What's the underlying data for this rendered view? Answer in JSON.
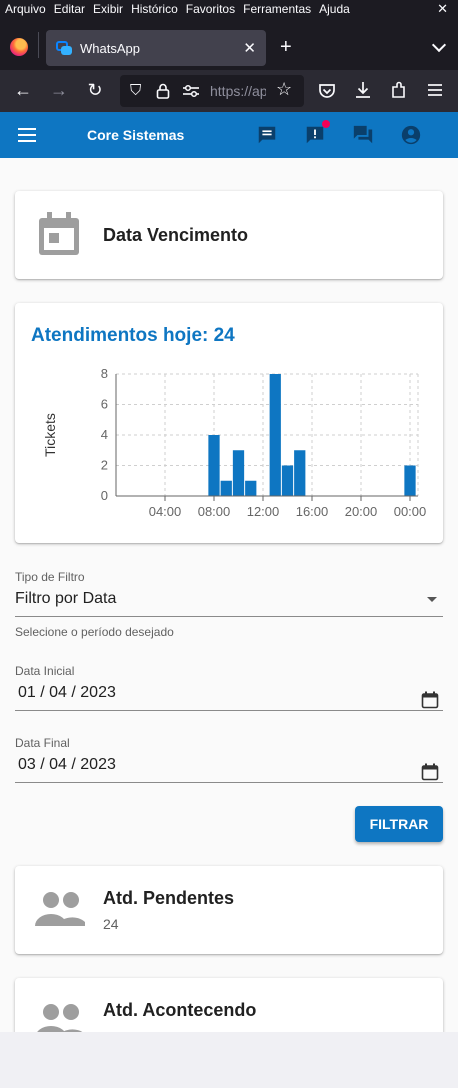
{
  "browser": {
    "menu": [
      "Arquivo",
      "Editar",
      "Exibir",
      "Histórico",
      "Favoritos",
      "Ferramentas",
      "Ajuda"
    ],
    "tab_title": "WhatsApp",
    "url_text": "https://ap",
    "icons": [
      "firefox-logo",
      "back-arrow",
      "forward-arrow",
      "reload",
      "shield",
      "lock",
      "permissions",
      "star",
      "pocket",
      "download",
      "extensions",
      "hamburger-menu"
    ]
  },
  "app": {
    "title": "Core Sistemas",
    "header_icons": [
      "chat-icon",
      "alert-icon",
      "forum-icon",
      "account-icon"
    ]
  },
  "due_card": {
    "title": "Data Vencimento",
    "icon": "calendar-icon"
  },
  "chart_card": {
    "title": "Atendimentos hoje: 24"
  },
  "chart_data": {
    "type": "bar",
    "ylabel": "Tickets",
    "xlabel": "",
    "ylim": [
      0,
      8
    ],
    "yticks": [
      "0",
      "2",
      "4",
      "6",
      "8"
    ],
    "xticks": [
      "04:00",
      "08:00",
      "12:00",
      "16:00",
      "20:00",
      "00:00"
    ],
    "x_range_hours": [
      0,
      24
    ],
    "bars": [
      {
        "hour": 8,
        "value": 4
      },
      {
        "hour": 9,
        "value": 1
      },
      {
        "hour": 10,
        "value": 3
      },
      {
        "hour": 11,
        "value": 1
      },
      {
        "hour": 13,
        "value": 8
      },
      {
        "hour": 14,
        "value": 2
      },
      {
        "hour": 15,
        "value": 3
      },
      {
        "hour": 24,
        "value": 2
      }
    ],
    "bar_color": "#0e76c2",
    "grid": true
  },
  "filter": {
    "type_label": "Tipo de Filtro",
    "type_value": "Filtro por Data",
    "helper": "Selecione o período desejado",
    "start_label": "Data Inicial",
    "start_value": "01 / 04 / 2023",
    "end_label": "Data Final",
    "end_value": "03 / 04 / 2023",
    "button": "FILTRAR"
  },
  "stats": [
    {
      "title": "Atd. Pendentes",
      "value": "24"
    },
    {
      "title": "Atd. Acontecendo",
      "value": ""
    }
  ],
  "colors": {
    "primary": "#0e76c2",
    "badge": "#f50057"
  }
}
